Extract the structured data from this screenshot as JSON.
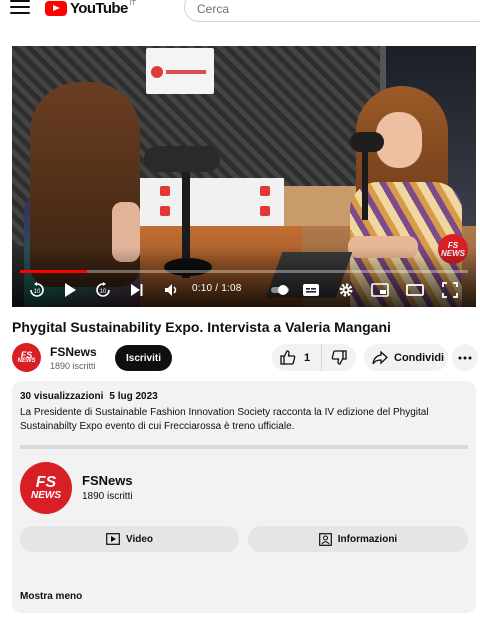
{
  "header": {
    "logo_text": "YouTube",
    "logo_sup": "IT",
    "search_placeholder": "Cerca"
  },
  "player": {
    "time_current": "0:10",
    "time_total": "1:08",
    "progress_fraction": 0.15,
    "watermark": "FS NEWS",
    "accent_color": "#ff0000"
  },
  "video": {
    "title": "Phygital Sustainability Expo. Intervista a Valeria Mangani"
  },
  "channel": {
    "name": "FSNews",
    "subscribers": "1890 iscritti",
    "avatar_line1": "FS",
    "avatar_line2": "NEWS",
    "subscribe_label": "Iscriviti"
  },
  "actions": {
    "like_count": "1",
    "share_label": "Condividi"
  },
  "description": {
    "views": "30 visualizzazioni",
    "date": "5 lug 2023",
    "text": "La Presidente di Sustainable Fashion Innovation Society racconta la IV edizione del Phygital Sustainabilty Expo evento di cui Frecciarossa è treno ufficiale.",
    "channel_name": "FSNews",
    "channel_subscribers": "1890 iscritti",
    "video_button": "Video",
    "info_button": "Informazioni",
    "show_less": "Mostra meno"
  },
  "colors": {
    "brand_red": "#d91f26",
    "youtube_red": "#ff0000"
  }
}
